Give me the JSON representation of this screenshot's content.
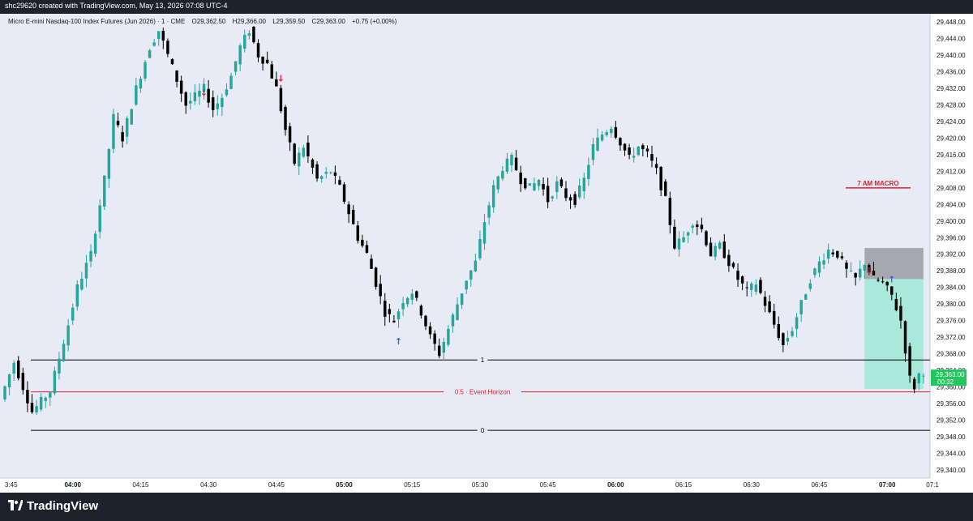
{
  "header": {
    "attribution": "shc29620 created with TradingView.com, May 13, 2026 07:08 UTC-4"
  },
  "symbol_info": {
    "name": "Micro E-mini Nasdaq-100 Index Futures (Jun 2026) · 1 · CME",
    "open": "O29,362.50",
    "high": "H29,366.00",
    "low": "L29,359.50",
    "close": "C29,363.00",
    "change": "+0.75 (+0.00%)"
  },
  "footer": {
    "brand": "TradingView"
  },
  "colors": {
    "plot_bg": "#e8eaf6",
    "up": "#26a69a",
    "down": "#000000",
    "annotation_red": "#e0202a",
    "marker_blue": "#2962ff",
    "price_label_bg": "#22c55e",
    "target_zone": "#a7e9d8",
    "stop_zone": "#9a9ca3"
  },
  "chart_data": {
    "type": "candlestick",
    "instrument": "Micro E-mini Nasdaq-100 Index Futures (Jun 2026)",
    "timeframe": "1",
    "x_axis": {
      "range": [
        "03:45",
        "07:10"
      ],
      "tick_labels": [
        "3:45",
        "04:00",
        "04:15",
        "04:30",
        "04:45",
        "05:00",
        "05:15",
        "05:30",
        "05:45",
        "06:00",
        "06:15",
        "06:30",
        "06:45",
        "07:00",
        "07:1"
      ],
      "bold_ticks": [
        "04:00",
        "05:00",
        "06:00",
        "07:00"
      ]
    },
    "y_axis": {
      "range": [
        29338,
        29450
      ],
      "tick_values": [
        29340,
        29344,
        29348,
        29352,
        29356,
        29360,
        29364,
        29368,
        29372,
        29376,
        29380,
        29384,
        29388,
        29392,
        29396,
        29400,
        29404,
        29408,
        29412,
        29416,
        29420,
        29424,
        29428,
        29432,
        29436,
        29440,
        29444,
        29448
      ],
      "tick_labels": [
        "29,340.00",
        "29,344.00",
        "29,348.00",
        "29,352.00",
        "29,356.00",
        "29,360.00",
        "29,364.00",
        "29,368.00",
        "29,372.00",
        "29,376.00",
        "29,380.00",
        "29,384.00",
        "29,388.00",
        "29,392.00",
        "29,396.00",
        "29,400.00",
        "29,404.00",
        "29,408.00",
        "29,412.00",
        "29,416.00",
        "29,420.00",
        "29,424.00",
        "29,428.00",
        "29,432.00",
        "29,436.00",
        "29,440.00",
        "29,444.00",
        "29,448.00"
      ]
    },
    "current_price": {
      "value": 29363,
      "label": "29,363.00",
      "countdown": "00:32"
    },
    "path": [
      [
        "03:45",
        29357
      ],
      [
        "03:48",
        29366
      ],
      [
        "03:50",
        29360
      ],
      [
        "03:52",
        29354
      ],
      [
        "03:56",
        29359
      ],
      [
        "04:00",
        29375
      ],
      [
        "04:02",
        29384
      ],
      [
        "04:05",
        29392
      ],
      [
        "04:08",
        29410
      ],
      [
        "04:10",
        29425
      ],
      [
        "04:12",
        29420
      ],
      [
        "04:15",
        29432
      ],
      [
        "04:18",
        29442
      ],
      [
        "04:20",
        29446
      ],
      [
        "04:22",
        29440
      ],
      [
        "04:24",
        29434
      ],
      [
        "04:26",
        29428
      ],
      [
        "04:28",
        29430
      ],
      [
        "04:30",
        29432
      ],
      [
        "04:32",
        29427
      ],
      [
        "04:34",
        29430
      ],
      [
        "04:36",
        29435
      ],
      [
        "04:38",
        29442
      ],
      [
        "04:40",
        29446
      ],
      [
        "04:42",
        29440
      ],
      [
        "04:44",
        29438
      ],
      [
        "04:46",
        29432
      ],
      [
        "04:48",
        29422
      ],
      [
        "04:50",
        29414
      ],
      [
        "04:52",
        29418
      ],
      [
        "04:55",
        29410
      ],
      [
        "04:58",
        29412
      ],
      [
        "05:00",
        29408
      ],
      [
        "05:02",
        29402
      ],
      [
        "05:04",
        29396
      ],
      [
        "05:06",
        29392
      ],
      [
        "05:08",
        29385
      ],
      [
        "05:10",
        29378
      ],
      [
        "05:12",
        29376
      ],
      [
        "05:14",
        29381
      ],
      [
        "05:16",
        29383
      ],
      [
        "05:18",
        29378
      ],
      [
        "05:20",
        29372
      ],
      [
        "05:22",
        29368
      ],
      [
        "05:24",
        29374
      ],
      [
        "05:26",
        29380
      ],
      [
        "05:28",
        29386
      ],
      [
        "05:30",
        29390
      ],
      [
        "05:32",
        29400
      ],
      [
        "05:34",
        29408
      ],
      [
        "05:36",
        29413
      ],
      [
        "05:38",
        29415
      ],
      [
        "05:40",
        29410
      ],
      [
        "05:42",
        29408
      ],
      [
        "05:44",
        29410
      ],
      [
        "05:46",
        29405
      ],
      [
        "05:48",
        29409
      ],
      [
        "05:50",
        29406
      ],
      [
        "05:52",
        29405
      ],
      [
        "05:54",
        29410
      ],
      [
        "05:56",
        29418
      ],
      [
        "05:58",
        29421
      ],
      [
        "06:00",
        29423
      ],
      [
        "06:02",
        29419
      ],
      [
        "06:04",
        29415
      ],
      [
        "06:06",
        29418
      ],
      [
        "06:08",
        29416
      ],
      [
        "06:10",
        29412
      ],
      [
        "06:12",
        29405
      ],
      [
        "06:14",
        29394
      ],
      [
        "06:16",
        29396
      ],
      [
        "06:18",
        29400
      ],
      [
        "06:20",
        29398
      ],
      [
        "06:22",
        29392
      ],
      [
        "06:24",
        29394
      ],
      [
        "06:26",
        29390
      ],
      [
        "06:28",
        29386
      ],
      [
        "06:30",
        29383
      ],
      [
        "06:32",
        29385
      ],
      [
        "06:34",
        29380
      ],
      [
        "06:36",
        29375
      ],
      [
        "06:38",
        29370
      ],
      [
        "06:40",
        29374
      ],
      [
        "06:42",
        29380
      ],
      [
        "06:44",
        29386
      ],
      [
        "06:46",
        29390
      ],
      [
        "06:48",
        29393
      ],
      [
        "06:50",
        29392
      ],
      [
        "06:52",
        29388
      ],
      [
        "06:54",
        29386
      ],
      [
        "06:56",
        29390
      ],
      [
        "06:58",
        29386
      ],
      [
        "07:00",
        29385
      ],
      [
        "07:02",
        29382
      ],
      [
        "07:04",
        29376
      ],
      [
        "07:06",
        29362
      ],
      [
        "07:07",
        29360
      ],
      [
        "07:08",
        29363
      ]
    ],
    "horizontal_lines": [
      {
        "price": 29366.5,
        "label": "1",
        "color": "#000000"
      },
      {
        "price": 29358.8,
        "label": "0.5 · Event Horizon",
        "color": "#e0202a"
      },
      {
        "price": 29349.5,
        "label": "0",
        "color": "#000000"
      }
    ],
    "annotations": [
      {
        "text": "7 AM MACRO",
        "x": "06:58",
        "price": 29408,
        "color": "#e0202a"
      }
    ],
    "position_zone": {
      "start": "06:55",
      "end": "07:08",
      "stop_top": 29393.5,
      "entry": 29386,
      "target_bottom": 29359.5
    },
    "signals": [
      {
        "type": "sell",
        "x": "04:29",
        "price": 29431
      },
      {
        "type": "sell",
        "x": "04:46",
        "price": 29434.5
      },
      {
        "type": "buy",
        "x": "05:12",
        "price": 29371
      },
      {
        "type": "sell",
        "x": "06:56",
        "price": 29388
      },
      {
        "type": "buy",
        "x": "07:01",
        "price": 29386
      }
    ]
  }
}
